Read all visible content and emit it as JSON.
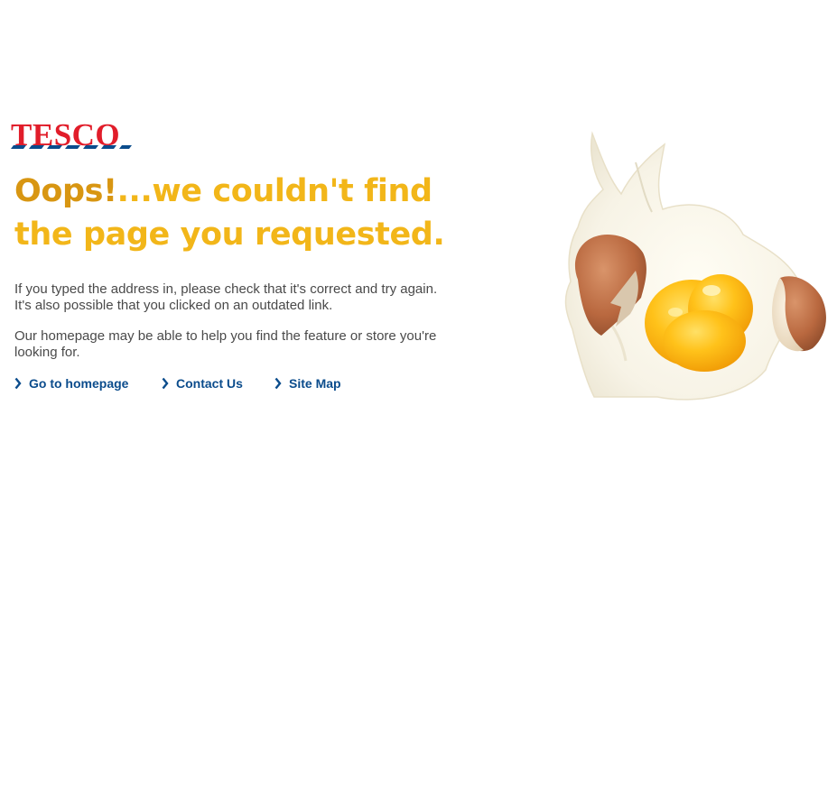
{
  "brand": {
    "logo_text": "TESCO",
    "logo_color": "#e11d2a",
    "stripe_color": "#0b4c8c"
  },
  "headline": {
    "oops": "Oops!",
    "line1_rest": "...we couldn't find",
    "line2": "the page you requested.",
    "oops_color": "#d89612",
    "rest_color": "#f2b619"
  },
  "message": {
    "paragraph1": "If you typed the address in, please check that it's correct and try again. It's also possible that you clicked on an outdated link.",
    "paragraph2": "Our homepage may be able to help you find the feature or store you're looking for."
  },
  "links": [
    {
      "label": "Go to homepage",
      "icon": "chevron-right-icon"
    },
    {
      "label": "Contact Us",
      "icon": "chevron-right-icon"
    },
    {
      "label": "Site Map",
      "icon": "chevron-right-icon"
    }
  ],
  "colors": {
    "link": "#0b4c8c",
    "body_text": "#4a4a4a",
    "background": "#ffffff"
  },
  "illustration": {
    "icon": "broken-egg-icon"
  }
}
